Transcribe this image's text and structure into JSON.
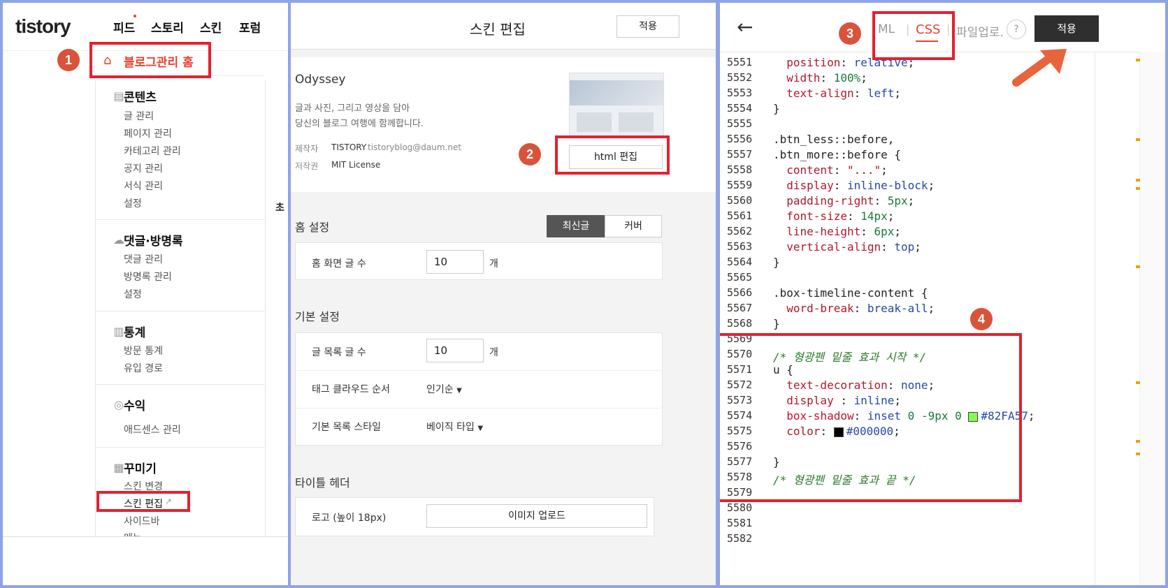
{
  "panel1": {
    "logo": "tistory",
    "nav": [
      "피드",
      "스토리",
      "스킨",
      "포럼"
    ],
    "home": "블로그관리 홈",
    "sections": [
      {
        "title": "콘텐츠",
        "icon": "document-icon",
        "items": [
          "글 관리",
          "페이지 관리",
          "카테고리 관리",
          "공지 관리",
          "서식 관리",
          "설정"
        ]
      },
      {
        "title": "댓글·방명록",
        "icon": "speech-bubble-icon",
        "items": [
          "댓글 관리",
          "방명록 관리",
          "설정"
        ]
      },
      {
        "title": "통계",
        "icon": "bar-chart-icon",
        "items": [
          "방문 통계",
          "유입 경로"
        ]
      },
      {
        "title": "수익",
        "icon": "coins-icon",
        "items": [
          "애드센스 관리"
        ]
      },
      {
        "title": "꾸미기",
        "icon": "layout-icon",
        "items": [
          "스킨 변경",
          "스킨 편집",
          "사이드바",
          "메뉴"
        ]
      }
    ],
    "cut_char": "초"
  },
  "panel2": {
    "title": "스킨 편집",
    "apply": "적용",
    "skin_name": "Odyssey",
    "desc1": "글과 사진, 그리고 영상을 담아",
    "desc2": "당신의 블로그 여행에 함께합니다.",
    "maker_label": "제작자",
    "maker_name": "TISTORY",
    "maker_email": "tistoryblog@daum.net",
    "license_label": "저작권",
    "license": "MIT License",
    "html_edit": "html 편집",
    "home_settings": "홈 설정",
    "tab_latest": "최신글",
    "tab_cover": "커버",
    "home_count_label": "홈 화면 글 수",
    "home_count": "10",
    "unit": "개",
    "basic_settings": "기본 설정",
    "list_count_label": "글 목록 글 수",
    "list_count": "10",
    "tag_order_label": "태그 클라우드 순서",
    "tag_order": "인기순",
    "list_style_label": "기본 목록 스타일",
    "list_style": "베이직 타입",
    "title_header": "타이틀 헤더",
    "logo_label": "로고 (높이 18px)",
    "image_upload": "이미지 업로드"
  },
  "panel3": {
    "tab_html": "ML",
    "tab_css": "CSS",
    "tab_file": "파일업로.",
    "help": "?",
    "apply": "적용",
    "line_numbers": [
      "5551",
      "5552",
      "5553",
      "5554",
      "5555",
      "5556",
      "5557",
      "5558",
      "5559",
      "5560",
      "5561",
      "5562",
      "5563",
      "5564",
      "5565",
      "5566",
      "5567",
      "5568",
      "5569",
      "5570",
      "5571",
      "5572",
      "5573",
      "5574",
      "5575",
      "5576",
      "5577",
      "5578",
      "5579",
      "5580",
      "5581",
      "5582"
    ],
    "swatch_green": "#82FA57",
    "swatch_black": "#000000"
  },
  "badges": [
    "1",
    "2",
    "3",
    "4"
  ],
  "colors": {
    "accent_red": "#e5202e",
    "badge": "#d9533b",
    "tistory_red": "#e8422e",
    "dark_button": "#2f2f2f"
  }
}
